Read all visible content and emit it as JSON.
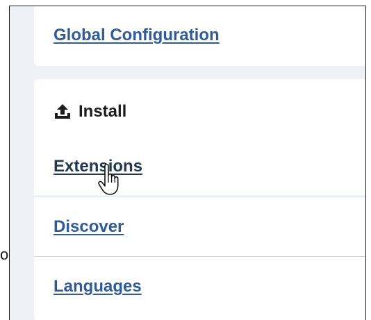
{
  "stray_char": "o",
  "global_config": {
    "label": "Global Configuration"
  },
  "install_section": {
    "icon": "upload-icon",
    "title": "Install",
    "items": [
      {
        "label": "Extensions",
        "state": "hover"
      },
      {
        "label": "Discover"
      },
      {
        "label": "Languages"
      }
    ]
  },
  "colors": {
    "link": "#2f5c99",
    "link_hover": "#24384f",
    "background": "#edf1f6",
    "card": "#ffffff",
    "divider": "#c9d6e6"
  }
}
